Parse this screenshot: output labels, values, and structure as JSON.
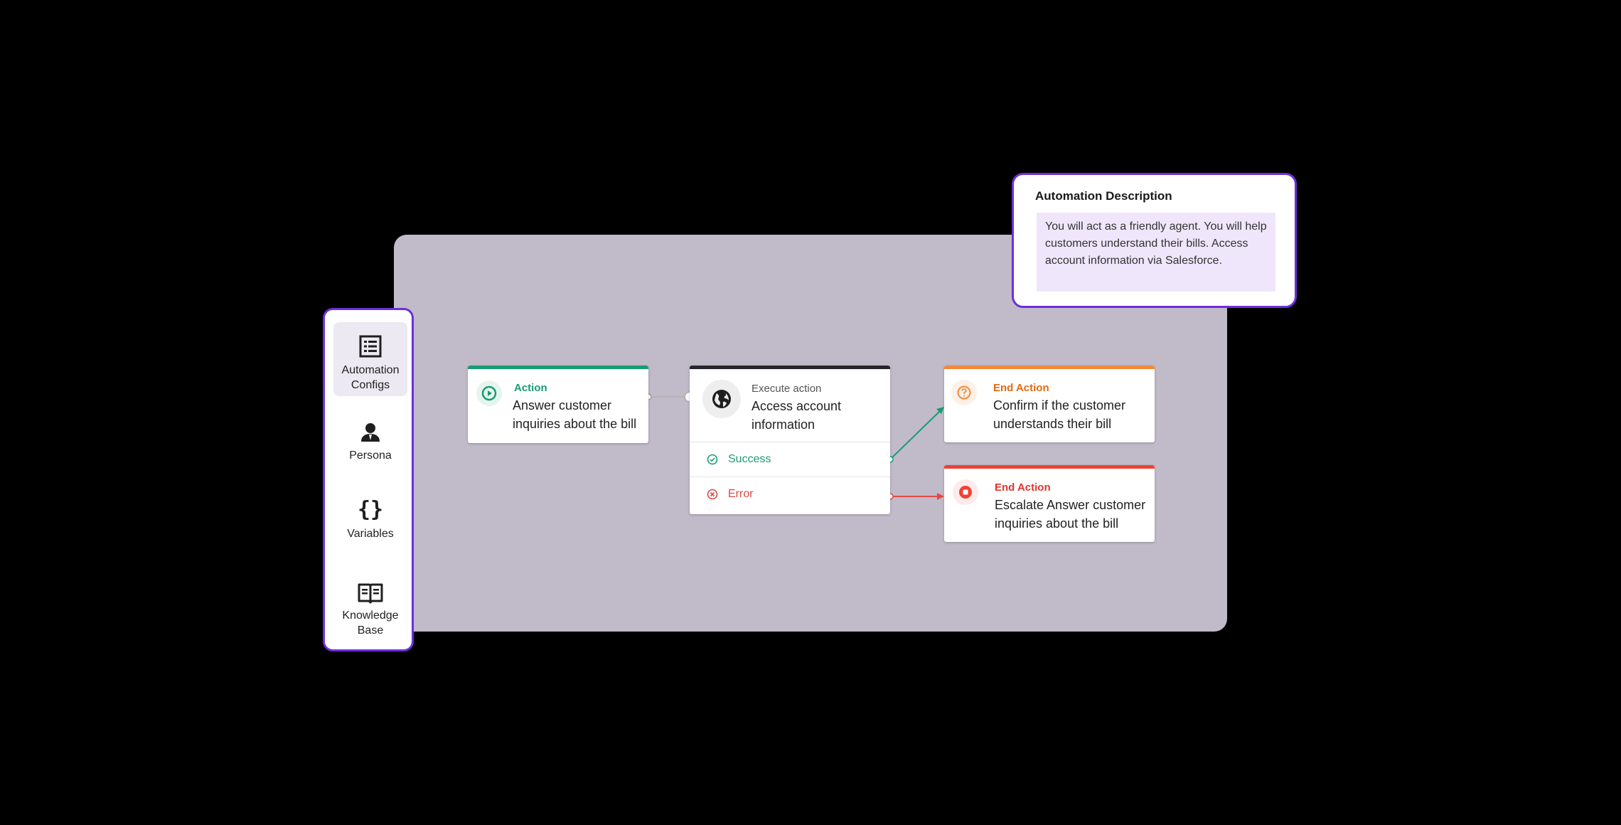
{
  "sidebar": {
    "items": [
      {
        "label": "Automation\nConfigs",
        "icon": "list-icon",
        "active": true
      },
      {
        "label": "Persona",
        "icon": "person-icon",
        "active": false
      },
      {
        "label": "Variables",
        "icon": "braces-icon",
        "active": false
      },
      {
        "label": "Knowledge\nBase",
        "icon": "book-icon",
        "active": false
      }
    ],
    "braces_glyph": "{}"
  },
  "description": {
    "title": "Automation Description",
    "body": "You will act as a friendly agent. You will help customers understand their bills. Access account information via Salesforce."
  },
  "nodes": {
    "action": {
      "kind": "Action",
      "text": "Answer customer inquiries about the bill",
      "color": "#169c73",
      "icon": "play-circle-icon"
    },
    "execute": {
      "kind": "Execute action",
      "text": "Access account information",
      "color": "#25262b",
      "icon": "globe-icon",
      "branches": [
        {
          "label": "Success",
          "color": "#1a9c73",
          "icon": "check-circle-icon"
        },
        {
          "label": "Error",
          "color": "#d94a43",
          "icon": "x-circle-icon"
        }
      ]
    },
    "end_confirm": {
      "kind": "End Action",
      "text": "Confirm if the customer understands their bill",
      "color": "#f08a3c",
      "text_color": "#e06a12",
      "icon": "question-circle-icon"
    },
    "end_escalate": {
      "kind": "End Action",
      "text": "Escalate Answer customer inquiries about the bill",
      "color": "#ee4237",
      "text_color": "#e0362d",
      "icon": "stop-circle-icon"
    }
  },
  "colors": {
    "canvas": "#c1bac9",
    "accent_purple": "#6d2fd8",
    "success_edge": "#1a9c73",
    "error_edge": "#e24b44"
  }
}
